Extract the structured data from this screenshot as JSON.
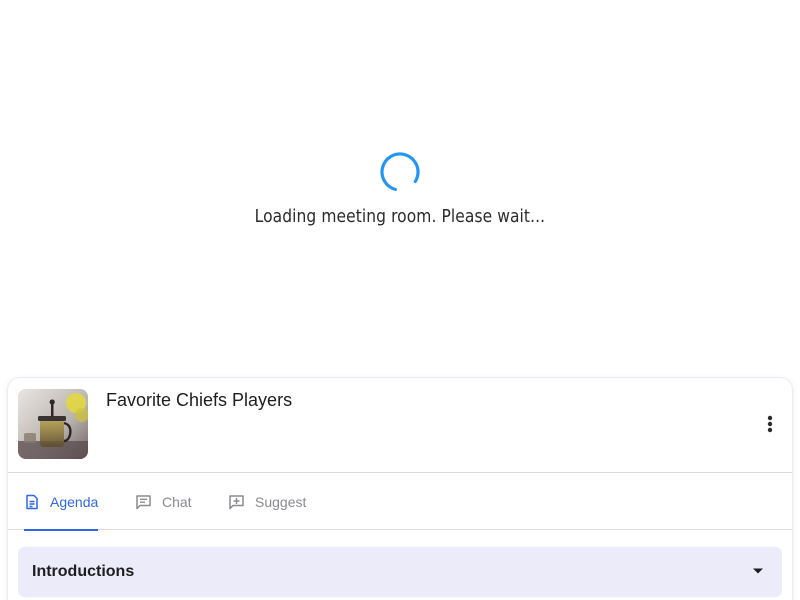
{
  "loading": {
    "message": "Loading meeting room. Please wait..."
  },
  "room": {
    "title": "Favorite Chiefs Players",
    "thumbnail_icon": "french-press-photo",
    "menu_icon": "more-vertical-icon"
  },
  "tabs": [
    {
      "label": "Agenda",
      "icon": "document-icon",
      "active": true
    },
    {
      "label": "Chat",
      "icon": "chat-icon",
      "active": false
    },
    {
      "label": "Suggest",
      "icon": "add-box-icon",
      "active": false
    }
  ],
  "agenda": {
    "items": [
      {
        "label": "Introductions",
        "expanded": false
      }
    ]
  },
  "colors": {
    "accent": "#2f67e6",
    "spinner": "#2196f3",
    "agenda_bg": "#ecebfa"
  }
}
